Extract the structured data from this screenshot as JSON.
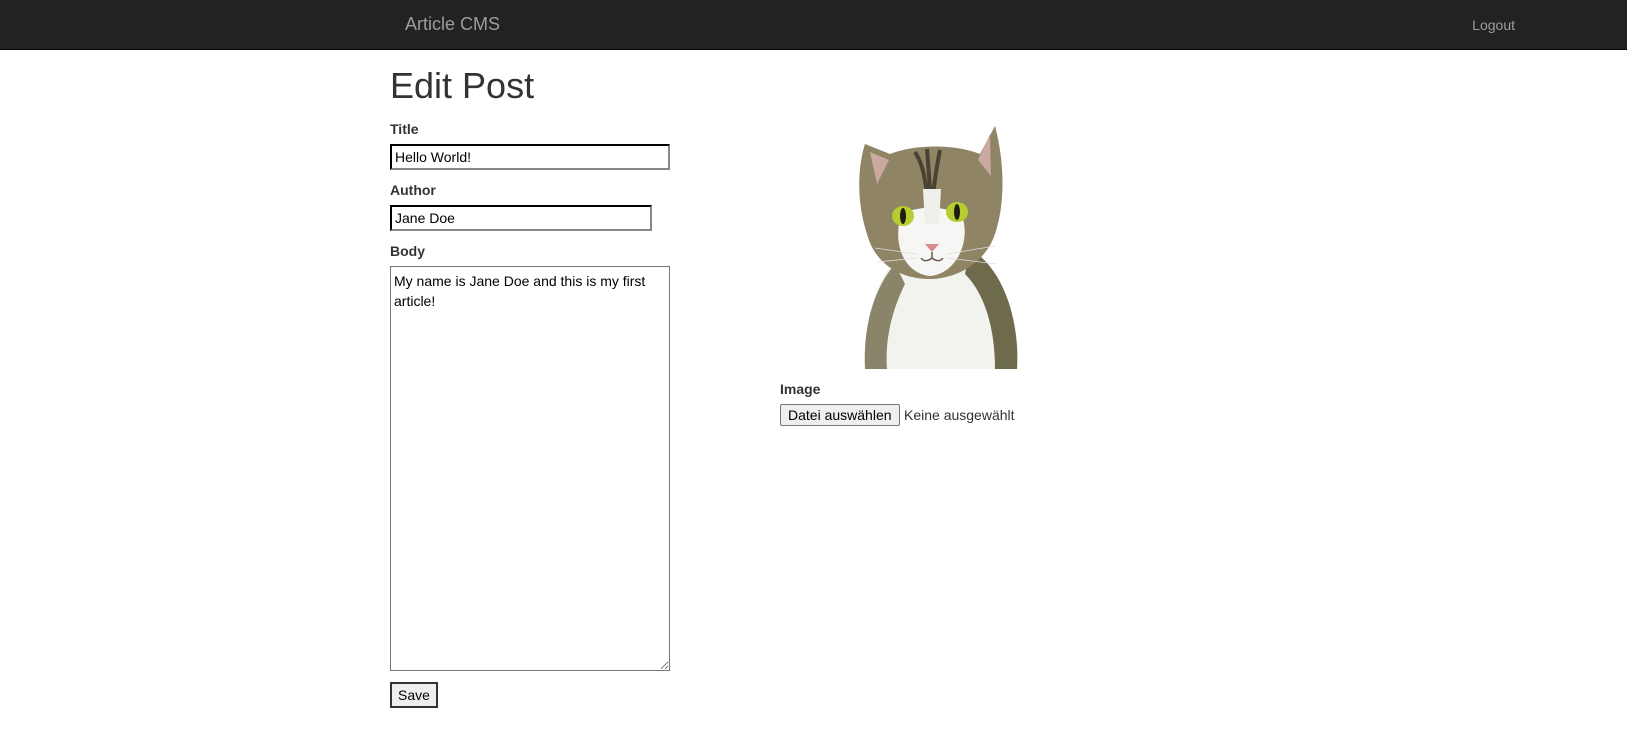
{
  "navbar": {
    "brand": "Article CMS",
    "logout_label": "Logout"
  },
  "page": {
    "title": "Edit Post"
  },
  "form": {
    "title_label": "Title",
    "title_value": "Hello World!",
    "author_label": "Author",
    "author_value": "Jane Doe",
    "body_label": "Body",
    "body_value": "My name is Jane Doe and this is my first article!",
    "save_label": "Save"
  },
  "image_section": {
    "label": "Image",
    "file_button_label": "Datei auswählen",
    "file_status": "Keine ausgewählt",
    "photo_icon": "cat-photo"
  },
  "colors": {
    "navbar_bg": "#222222",
    "navbar_text": "#9d9d9d",
    "text": "#333333"
  }
}
